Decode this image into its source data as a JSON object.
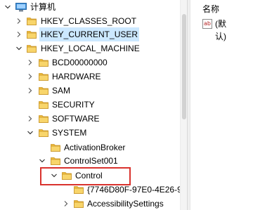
{
  "tree": {
    "root_label": "计算机",
    "nodes": [
      {
        "label": "HKEY_CLASSES_ROOT"
      },
      {
        "label": "HKEY_CURRENT_USER"
      },
      {
        "label": "HKEY_LOCAL_MACHINE"
      },
      {
        "label": "BCD00000000"
      },
      {
        "label": "HARDWARE"
      },
      {
        "label": "SAM"
      },
      {
        "label": "SECURITY"
      },
      {
        "label": "SOFTWARE"
      },
      {
        "label": "SYSTEM"
      },
      {
        "label": "ActivationBroker"
      },
      {
        "label": "ControlSet001"
      },
      {
        "label": "Control"
      },
      {
        "label": "{7746D80F-97E0-4E26-9"
      },
      {
        "label": "AccessibilitySettings"
      }
    ]
  },
  "list": {
    "header_name": "名称",
    "rows": [
      {
        "icon": "ab",
        "name": "(默认)"
      }
    ]
  },
  "colors": {
    "selection": "#cce8ff",
    "highlight_border": "#d9322d",
    "folder": "#f5c94c"
  }
}
